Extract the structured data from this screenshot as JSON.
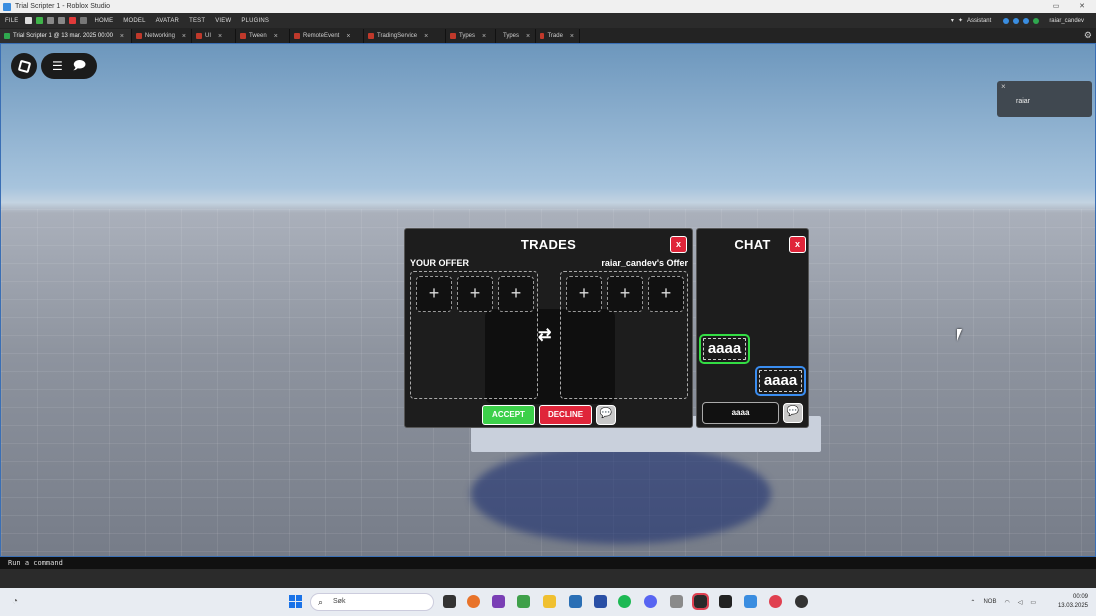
{
  "window": {
    "title": "Trial Scripter 1 - Roblox Studio"
  },
  "ribbon": {
    "menus": [
      "FILE",
      "HOME",
      "MODEL",
      "AVATAR",
      "TEST",
      "VIEW",
      "PLUGINS"
    ],
    "assistant": "Assistant",
    "user": "raiar_candev"
  },
  "tabs": [
    {
      "label": "Trial Scripter 1 @ 13 mar. 2025 00:00",
      "active": true
    },
    {
      "label": "Networking"
    },
    {
      "label": "UI"
    },
    {
      "label": "Tween"
    },
    {
      "label": "RemoteEvent"
    },
    {
      "label": "TradingService"
    },
    {
      "label": "Types"
    },
    {
      "label": "Types"
    },
    {
      "label": "Trade"
    }
  ],
  "toast": {
    "name": "raiar"
  },
  "trades": {
    "title": "TRADES",
    "close": "x",
    "your_offer": "YOUR OFFER",
    "their_offer": "raiar_candev's Offer",
    "slot_symbol": "+",
    "swap": "⇄",
    "accept": "ACCEPT",
    "decline": "DECLINE"
  },
  "chat": {
    "title": "CHAT",
    "close": "x",
    "messages": [
      {
        "text": "aaaa",
        "from": "me"
      },
      {
        "text": "aaaa",
        "from": "other"
      }
    ],
    "input_value": "aaaa"
  },
  "command_bar": {
    "placeholder": "Run a command"
  },
  "taskbar": {
    "search": "Søk",
    "lang": "NOB",
    "time": "00:09",
    "date": "13.03.2025"
  },
  "colors": {
    "accept": "#3cd04a",
    "decline": "#e0253a",
    "me_border": "#33dd44",
    "other_border": "#3a8df0"
  }
}
